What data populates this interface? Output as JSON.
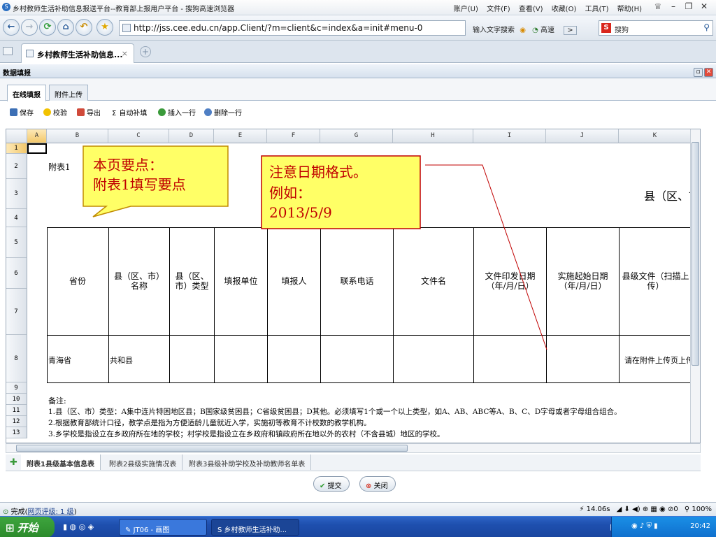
{
  "window": {
    "title": "乡村教师生活补助信息报送平台--教育部上报用户平台 - 搜狗高速浏览器",
    "menus": [
      "账户(U)",
      "文件(F)",
      "查看(V)",
      "收藏(O)",
      "工具(T)",
      "帮助(H)"
    ]
  },
  "nav": {
    "url": "http://jss.cee.edu.cn/app.Client/?m=client&c=index&a=init#menu-0",
    "input_hint": "输入文字搜索",
    "speed": "高速",
    "search_placeholder": "搜狗"
  },
  "browser_tab": {
    "label": "乡村教师生活补助信息..."
  },
  "panel": {
    "title": "数据填报",
    "subtabs": [
      "在线填报",
      "附件上传"
    ]
  },
  "toolbar": {
    "save": "保存",
    "verify": "校验",
    "export": "导出",
    "autofill": "自动补填",
    "insert_row": "插入一行",
    "delete_row": "删除一行"
  },
  "grid": {
    "col_letters": [
      "A",
      "B",
      "C",
      "D",
      "E",
      "F",
      "G",
      "H",
      "I",
      "J",
      "K"
    ],
    "row_numbers": [
      "1",
      "2",
      "3",
      "4",
      "5",
      "6",
      "7",
      "8",
      "9",
      "10",
      "11",
      "12",
      "13"
    ],
    "appendix_label": "附表1",
    "county_suffix": "县（区、市",
    "headers": {
      "province": "省份",
      "county_name": "县（区、市）名称",
      "county_type": "县（区、市）类型",
      "unit": "填报单位",
      "reporter": "填报人",
      "phone": "联系电话",
      "doc_name": "文件名",
      "issue_date": "文件印发日期（年/月/日）",
      "start_date": "实施起始日期（年/月/日）",
      "county_doc": "县级文件（扫描上传）"
    },
    "row8": {
      "province": "青海省",
      "county": "共和县",
      "upload_hint": "请在附件上传页上传"
    },
    "notes_title": "备注:",
    "notes": [
      "1.县（区、市）类型：A集中连片特困地区县；B国家级贫困县；C省级贫困县；D其他。必须填写1个或一个以上类型，如A、AB、ABC等A、B、C、D字母或者字母组合组合。",
      "2.根据教育部统计口径，教学点是指为方便适龄儿童就近入学，实施初等教育不计校数的教学机构。",
      "3.乡学校是指设立在乡政府所在地的学校；村学校是指设立在乡政府和镇政府所在地以外的农村（不含县城）地区的学校。"
    ]
  },
  "callouts": {
    "left_line1": "本页要点：",
    "left_line2": "附表1填写要点",
    "right_line1": "注意日期格式。",
    "right_line2": "例如：",
    "right_line3": "2013/5/9"
  },
  "sheet_tabs": [
    "附表1县级基本信息表",
    "附表2县级实施情况表",
    "附表3县级补助学校及补助教师名单表"
  ],
  "actions": {
    "submit": "提交",
    "close": "关闭"
  },
  "status": {
    "left": "完成(",
    "rating": "网页评级: 1 级",
    "left_end": ")",
    "speed": "14.06s",
    "zoom": "100%"
  },
  "taskbar": {
    "start": "开始",
    "task1": "JT06 - 画图",
    "task2": "乡村教师生活补助...",
    "clock": "20:42"
  },
  "colors": {
    "callout_fill": "#ffff66",
    "callout_text": "#c00000",
    "taskbar": "#1e4fae"
  }
}
